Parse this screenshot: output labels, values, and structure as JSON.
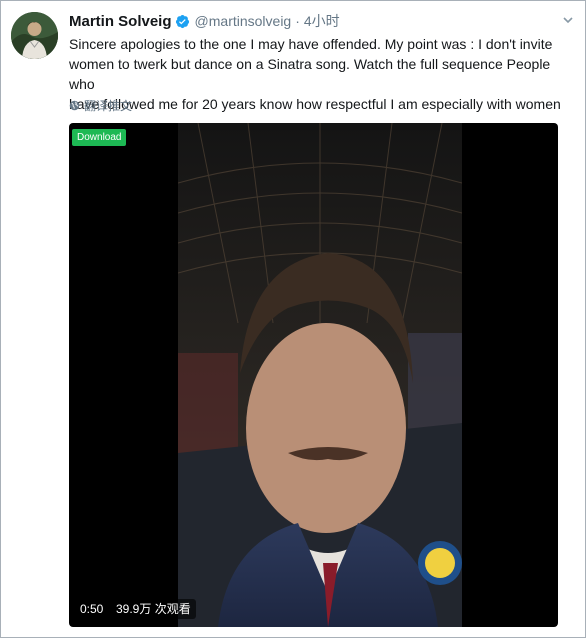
{
  "tweet": {
    "display_name": "Martin Solveig",
    "handle": "@martinsolveig",
    "separator": "·",
    "time": "4小时",
    "text": "Sincere apologies to the one I may have offended. My point was : I don't invite\nwomen to twerk but dance on a Sinatra song. Watch the full sequence People who\nhave followed me for 20 years know how respectful I am especially with women",
    "translate_label": "翻译推文",
    "verified": true
  },
  "video": {
    "download_label": "Download",
    "duration": "0:50",
    "views": "39.9万 次观看"
  },
  "colors": {
    "verified_blue": "#1da1f2",
    "download_green": "#1db954",
    "muted_text": "#657786"
  },
  "icons": {
    "verified": "verified-badge-icon",
    "globe": "globe-icon",
    "menu": "chevron-down-icon"
  }
}
